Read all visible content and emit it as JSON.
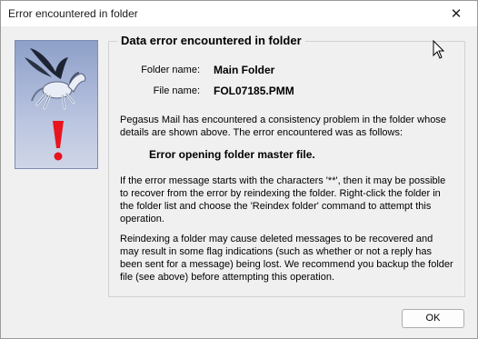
{
  "window": {
    "title": "Error encountered in folder"
  },
  "group": {
    "title": "Data error encountered in folder"
  },
  "fields": {
    "folder_label": "Folder name:",
    "folder_value": "Main Folder",
    "file_label": "File name:",
    "file_value": "FOL07185.PMM"
  },
  "message": {
    "intro": "Pegasus Mail has encountered a consistency problem in the folder whose details are shown above. The error encountered was as follows:",
    "error": "Error opening folder master file.",
    "reindex": "If the error message starts with the characters '**', then it may be possible to recover from the error by reindexing the folder. Right-click the folder in the folder list and choose the 'Reindex folder' command to attempt this operation.",
    "warning": "Reindexing a folder may cause deleted messages to be recovered and may result in some flag indications (such as whether or not a reply has been sent for a message) being lost. We recommend you backup the folder file (see above) before attempting this operation."
  },
  "buttons": {
    "ok": "OK"
  },
  "icons": {
    "close": "close-icon",
    "pegasus": "pegasus-icon",
    "warning": "exclamation-icon",
    "cursor": "mouse-cursor-icon"
  },
  "colors": {
    "exclamation": "#e8141e",
    "panel": "#a6b4d6"
  }
}
